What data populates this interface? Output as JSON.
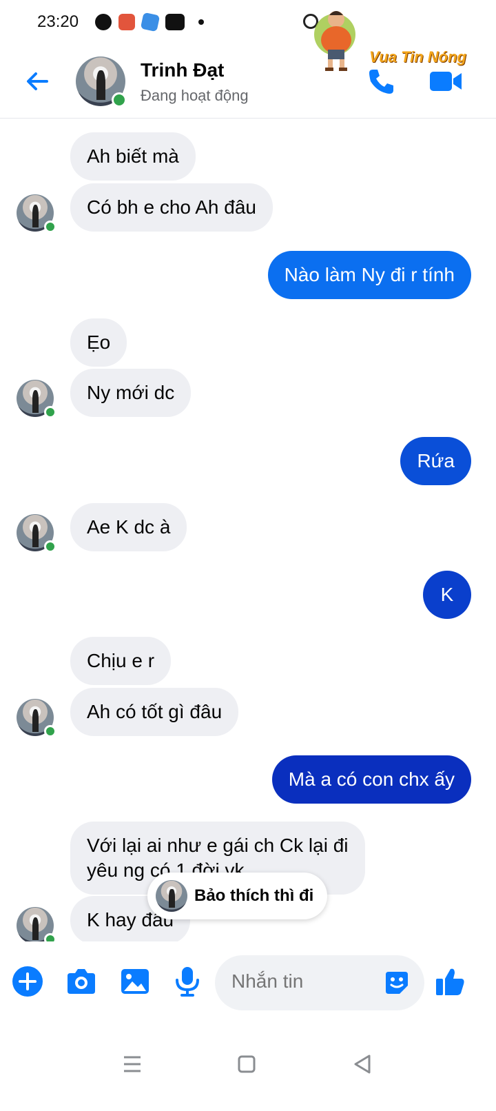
{
  "status_bar": {
    "time": "23:20"
  },
  "watermark": {
    "text": "Vua Tin Nóng"
  },
  "header": {
    "name": "Trinh Đạt",
    "status": "Đang hoạt động"
  },
  "colors": {
    "accent": "#0a7cff",
    "incoming_bg": "#eeeff3",
    "online": "#31a24c"
  },
  "messages": [
    {
      "dir": "in",
      "text": "Ah biết mà"
    },
    {
      "dir": "in",
      "text": "Có bh e cho Ah đâu"
    },
    {
      "dir": "out",
      "text": "Nào làm Ny đi r tính"
    },
    {
      "dir": "in",
      "text": "Ẹo"
    },
    {
      "dir": "in",
      "text": "Ny mới dc"
    },
    {
      "dir": "out",
      "text": "Rứa"
    },
    {
      "dir": "in",
      "text": "Ae K dc à"
    },
    {
      "dir": "out",
      "text": "K"
    },
    {
      "dir": "in",
      "text": "Chịu e r"
    },
    {
      "dir": "in",
      "text": "Ah có tốt gì đâu"
    },
    {
      "dir": "out",
      "text": "Mà a có con chx ấy"
    },
    {
      "dir": "in",
      "line1": "Với lại ai như e gái ch Ck lại đi",
      "line2": "yêu ng có 1 đời vk"
    },
    {
      "dir": "in",
      "text": "K hay đâu"
    }
  ],
  "reply_preview": {
    "text": "Bảo thích thì đi"
  },
  "composer": {
    "placeholder": "Nhắn tin"
  },
  "icons": [
    "back-arrow-icon",
    "phone-icon",
    "video-camera-icon",
    "plus-icon",
    "camera-icon",
    "image-icon",
    "microphone-icon",
    "sticker-icon",
    "thumbs-up-icon",
    "menu-icon",
    "home-icon",
    "back-icon"
  ]
}
